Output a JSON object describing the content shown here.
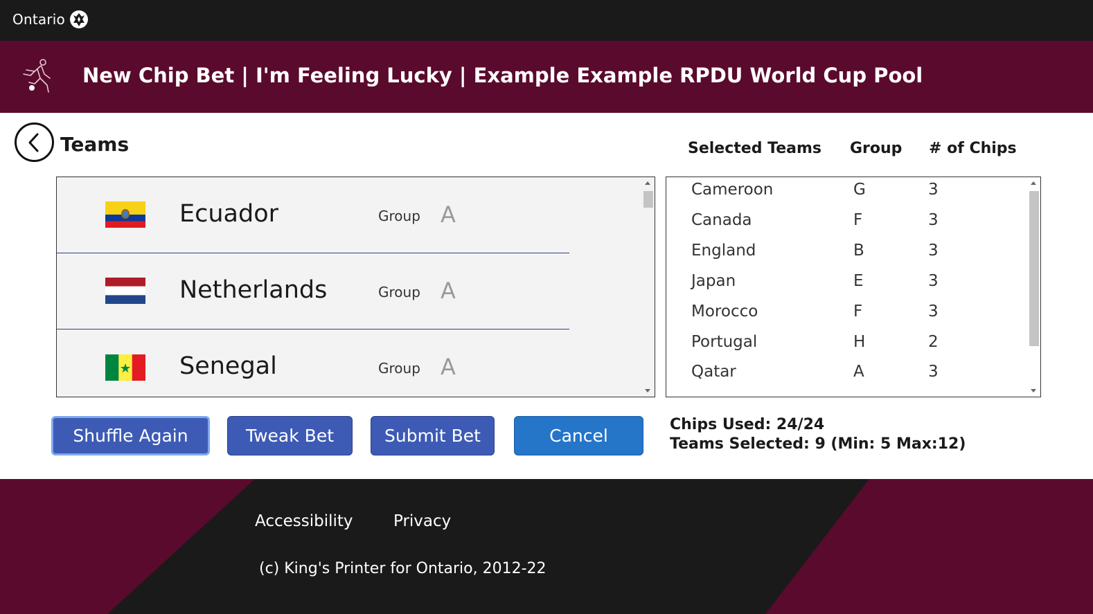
{
  "top_bar": {
    "logo_text": "Ontario",
    "logo_icon": "trillium-icon"
  },
  "header": {
    "title": "New Chip Bet | I'm Feeling Lucky | Example Example RPDU World Cup Pool",
    "icon": "soccer-player-icon"
  },
  "page": {
    "section_label": "Teams",
    "back_icon": "chevron-left-icon"
  },
  "team_list": {
    "items": [
      {
        "name": "Ecuador",
        "group_label": "Group",
        "group": "A",
        "flag": "ecuador-flag"
      },
      {
        "name": "Netherlands",
        "group_label": "Group",
        "group": "A",
        "flag": "netherlands-flag"
      },
      {
        "name": "Senegal",
        "group_label": "Group",
        "group": "A",
        "flag": "senegal-flag"
      }
    ]
  },
  "selected_table": {
    "headers": [
      "Selected Teams",
      "Group",
      "# of Chips"
    ],
    "rows": [
      [
        "Cameroon",
        "G",
        "3"
      ],
      [
        "Canada",
        "F",
        "3"
      ],
      [
        "England",
        "B",
        "3"
      ],
      [
        "Japan",
        "E",
        "3"
      ],
      [
        "Morocco",
        "F",
        "3"
      ],
      [
        "Portugal",
        "H",
        "2"
      ],
      [
        "Qatar",
        "A",
        "3"
      ]
    ]
  },
  "actions": {
    "shuffle_label": "Shuffle Again",
    "tweak_label": "Tweak Bet",
    "submit_label": "Submit Bet",
    "cancel_label": "Cancel"
  },
  "stats": {
    "chips_used": "Chips Used: 24/24",
    "teams_selected": "Teams Selected: 9 (Min: 5 Max:12)"
  },
  "footer": {
    "accessibility_label": "Accessibility",
    "privacy_label": "Privacy",
    "copyright": "(c) King's Printer for Ontario, 2012-22"
  },
  "colors": {
    "top_bar": "#1a1a1a",
    "header": "#5a0a2c",
    "primary_button": "#3d5bb5",
    "cancel_button": "#2575c9",
    "divider": "#2c3e8a"
  }
}
